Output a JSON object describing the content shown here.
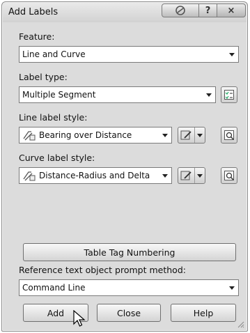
{
  "window": {
    "title": "Add Labels"
  },
  "feature": {
    "label": "Feature:",
    "value": "Line and Curve"
  },
  "label_type": {
    "label": "Label type:",
    "value": "Multiple Segment"
  },
  "line_label_style": {
    "label": "Line label style:",
    "value": "Bearing over Distance"
  },
  "curve_label_style": {
    "label": "Curve label style:",
    "value": "Distance-Radius and Delta"
  },
  "table_tag_button": "Table Tag Numbering",
  "reference": {
    "label": "Reference text object prompt method:",
    "value": "Command Line"
  },
  "buttons": {
    "add": "Add",
    "close": "Close",
    "help": "Help"
  },
  "titlebar_buttons": {
    "help": "?",
    "close": "×"
  },
  "icons": {
    "help_globe": "help-globe-icon",
    "style_icon": "label-style-icon",
    "edit": "edit-style-icon",
    "preview": "preview-icon",
    "checklist": "checklist-icon"
  }
}
